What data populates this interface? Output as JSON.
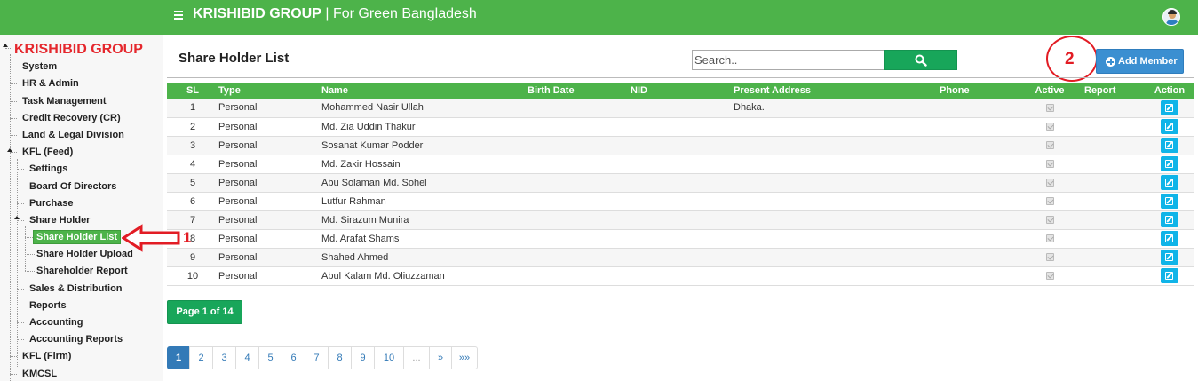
{
  "header": {
    "brand": "KRISHIBID GROUP",
    "separator": " | ",
    "tagline": "For Green Bangladesh"
  },
  "sidebar": {
    "title": "KRISHIBID GROUP",
    "items": [
      {
        "label": "System"
      },
      {
        "label": "HR & Admin"
      },
      {
        "label": "Task Management"
      },
      {
        "label": "Credit Recovery (CR)"
      },
      {
        "label": "Land & Legal Division"
      },
      {
        "label": "KFL (Feed)"
      },
      {
        "label": "Settings"
      },
      {
        "label": "Board Of Directors"
      },
      {
        "label": "Purchase"
      },
      {
        "label": "Share Holder"
      },
      {
        "label": "Share Holder List"
      },
      {
        "label": "Share Holder Upload"
      },
      {
        "label": "Shareholder Report"
      },
      {
        "label": "Sales & Distribution"
      },
      {
        "label": "Reports"
      },
      {
        "label": "Accounting"
      },
      {
        "label": "Accounting Reports"
      },
      {
        "label": "KFL (Firm)"
      },
      {
        "label": "KMCSL"
      }
    ]
  },
  "main": {
    "title": "Share Holder List",
    "search_placeholder": "Search..",
    "add_button": "Add Member",
    "annotation_1": "1",
    "annotation_2": "2",
    "columns": [
      "SL",
      "Type",
      "Name",
      "Birth Date",
      "NID",
      "Present Address",
      "Phone",
      "Active",
      "Report",
      "Action"
    ],
    "rows": [
      {
        "sl": "1",
        "type": "Personal",
        "name": "Mohammed Nasir Ullah",
        "birth": "",
        "nid": "",
        "address": "Dhaka.",
        "phone": ""
      },
      {
        "sl": "2",
        "type": "Personal",
        "name": "Md. Zia Uddin Thakur",
        "birth": "",
        "nid": "",
        "address": "",
        "phone": ""
      },
      {
        "sl": "3",
        "type": "Personal",
        "name": "Sosanat Kumar Podder",
        "birth": "",
        "nid": "",
        "address": "",
        "phone": ""
      },
      {
        "sl": "4",
        "type": "Personal",
        "name": "Md. Zakir Hossain",
        "birth": "",
        "nid": "",
        "address": "",
        "phone": ""
      },
      {
        "sl": "5",
        "type": "Personal",
        "name": "Abu Solaman Md. Sohel",
        "birth": "",
        "nid": "",
        "address": "",
        "phone": ""
      },
      {
        "sl": "6",
        "type": "Personal",
        "name": "Lutfur Rahman",
        "birth": "",
        "nid": "",
        "address": "",
        "phone": ""
      },
      {
        "sl": "7",
        "type": "Personal",
        "name": "Md. Sirazum Munira",
        "birth": "",
        "nid": "",
        "address": "",
        "phone": ""
      },
      {
        "sl": "8",
        "type": "Personal",
        "name": "Md. Arafat Shams",
        "birth": "",
        "nid": "",
        "address": "",
        "phone": ""
      },
      {
        "sl": "9",
        "type": "Personal",
        "name": "Shahed Ahmed",
        "birth": "",
        "nid": "",
        "address": "",
        "phone": ""
      },
      {
        "sl": "10",
        "type": "Personal",
        "name": "Abul Kalam Md. Oliuzzaman",
        "birth": "",
        "nid": "",
        "address": "",
        "phone": ""
      }
    ],
    "page_info": "Page 1 of 14",
    "pager": [
      "1",
      "2",
      "3",
      "4",
      "5",
      "6",
      "7",
      "8",
      "9",
      "10",
      "...",
      "»",
      "»»"
    ]
  },
  "colors": {
    "header_green": "#4db34a",
    "search_green": "#18a65a",
    "add_blue": "#3b8fd1",
    "edit_cyan": "#10b4e8",
    "title_red": "#e5272d",
    "annotation_red": "#e21c24"
  }
}
